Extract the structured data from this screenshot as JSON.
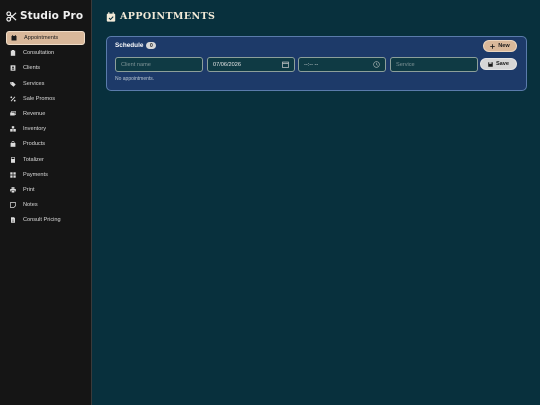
{
  "app": {
    "brand": "Studio Pro"
  },
  "sidebar": {
    "items": [
      {
        "label": "Appointments",
        "icon": "calendar-icon",
        "active": true
      },
      {
        "label": "Consultation",
        "icon": "clipboard-icon"
      },
      {
        "label": "Clients",
        "icon": "address-book-icon"
      },
      {
        "label": "Services",
        "icon": "tags-icon"
      },
      {
        "label": "Sale Promos",
        "icon": "percent-icon"
      },
      {
        "label": "Revenue",
        "icon": "money-icon"
      },
      {
        "label": "Inventory",
        "icon": "boxes-icon"
      },
      {
        "label": "Products",
        "icon": "bag-icon"
      },
      {
        "label": "Totalizer",
        "icon": "calculator-icon"
      },
      {
        "label": "Payments",
        "icon": "grid-icon"
      },
      {
        "label": "Print",
        "icon": "printer-icon"
      },
      {
        "label": "Notes",
        "icon": "note-icon"
      },
      {
        "label": "Consult Pricing",
        "icon": "document-icon"
      }
    ]
  },
  "main": {
    "title": "Appointments",
    "schedule": {
      "title": "Schedule",
      "count": "0",
      "new_label": "New",
      "save_label": "Save",
      "client_placeholder": "Client name",
      "date_value": "07/06/2026",
      "time_value": "--:-- --",
      "service_placeholder": "Service",
      "empty_text": "No appointments."
    }
  },
  "colors": {
    "background": "#08303d",
    "sidebar": "#151515",
    "accent": "#d9b89a",
    "card": "#1d3a69"
  }
}
